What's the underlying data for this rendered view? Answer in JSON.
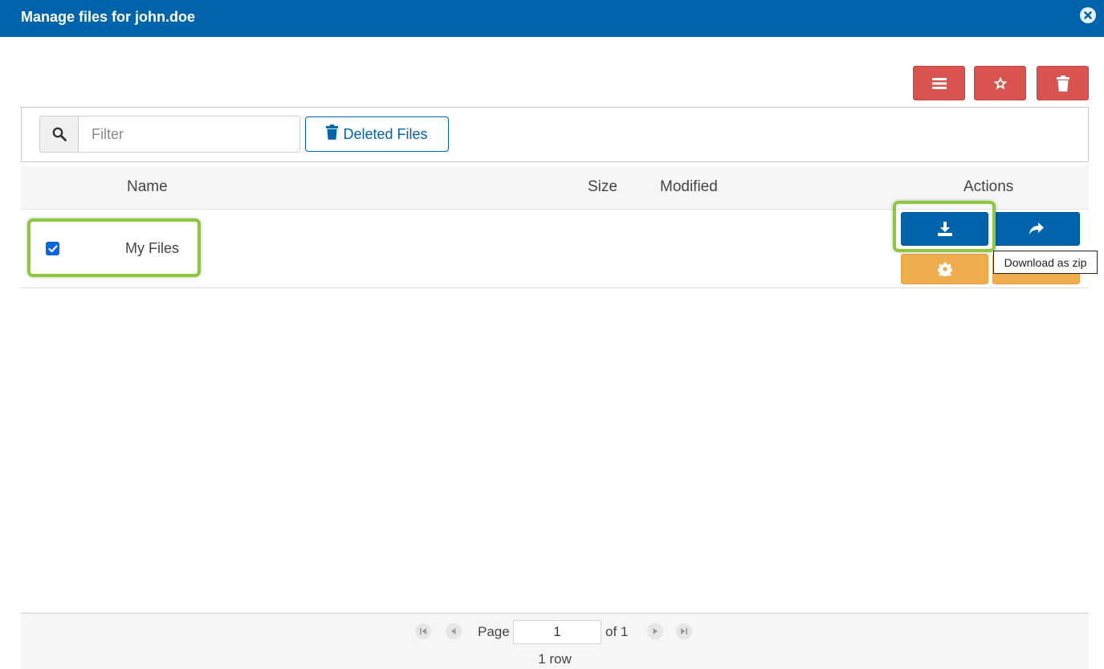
{
  "dialog": {
    "title": "Manage files for john.doe"
  },
  "toolbar": {
    "buttons": [
      {
        "icon": "menu-icon"
      },
      {
        "icon": "star-icon"
      },
      {
        "icon": "trash-icon"
      }
    ]
  },
  "filter": {
    "placeholder": "Filter",
    "value": "",
    "deleted_files_label": "Deleted Files"
  },
  "table": {
    "columns": [
      "Name",
      "Size",
      "Modified",
      "Actions"
    ],
    "rows": [
      {
        "checked": true,
        "name": "My Files",
        "size": "",
        "modified": ""
      }
    ]
  },
  "actions": {
    "download_icon": "download-icon",
    "share_icon": "share-icon",
    "settings_icon": "gear-icon",
    "tooltip": "Download as zip"
  },
  "pagination": {
    "page_label": "Page",
    "page_value": "1",
    "of_label": "of 1",
    "row_count": "1 row"
  },
  "colors": {
    "header": "#0064ad",
    "danger": "#d9534f",
    "primary": "#0064ad",
    "warning": "#f0ad4e",
    "highlight": "#8dc63f"
  }
}
